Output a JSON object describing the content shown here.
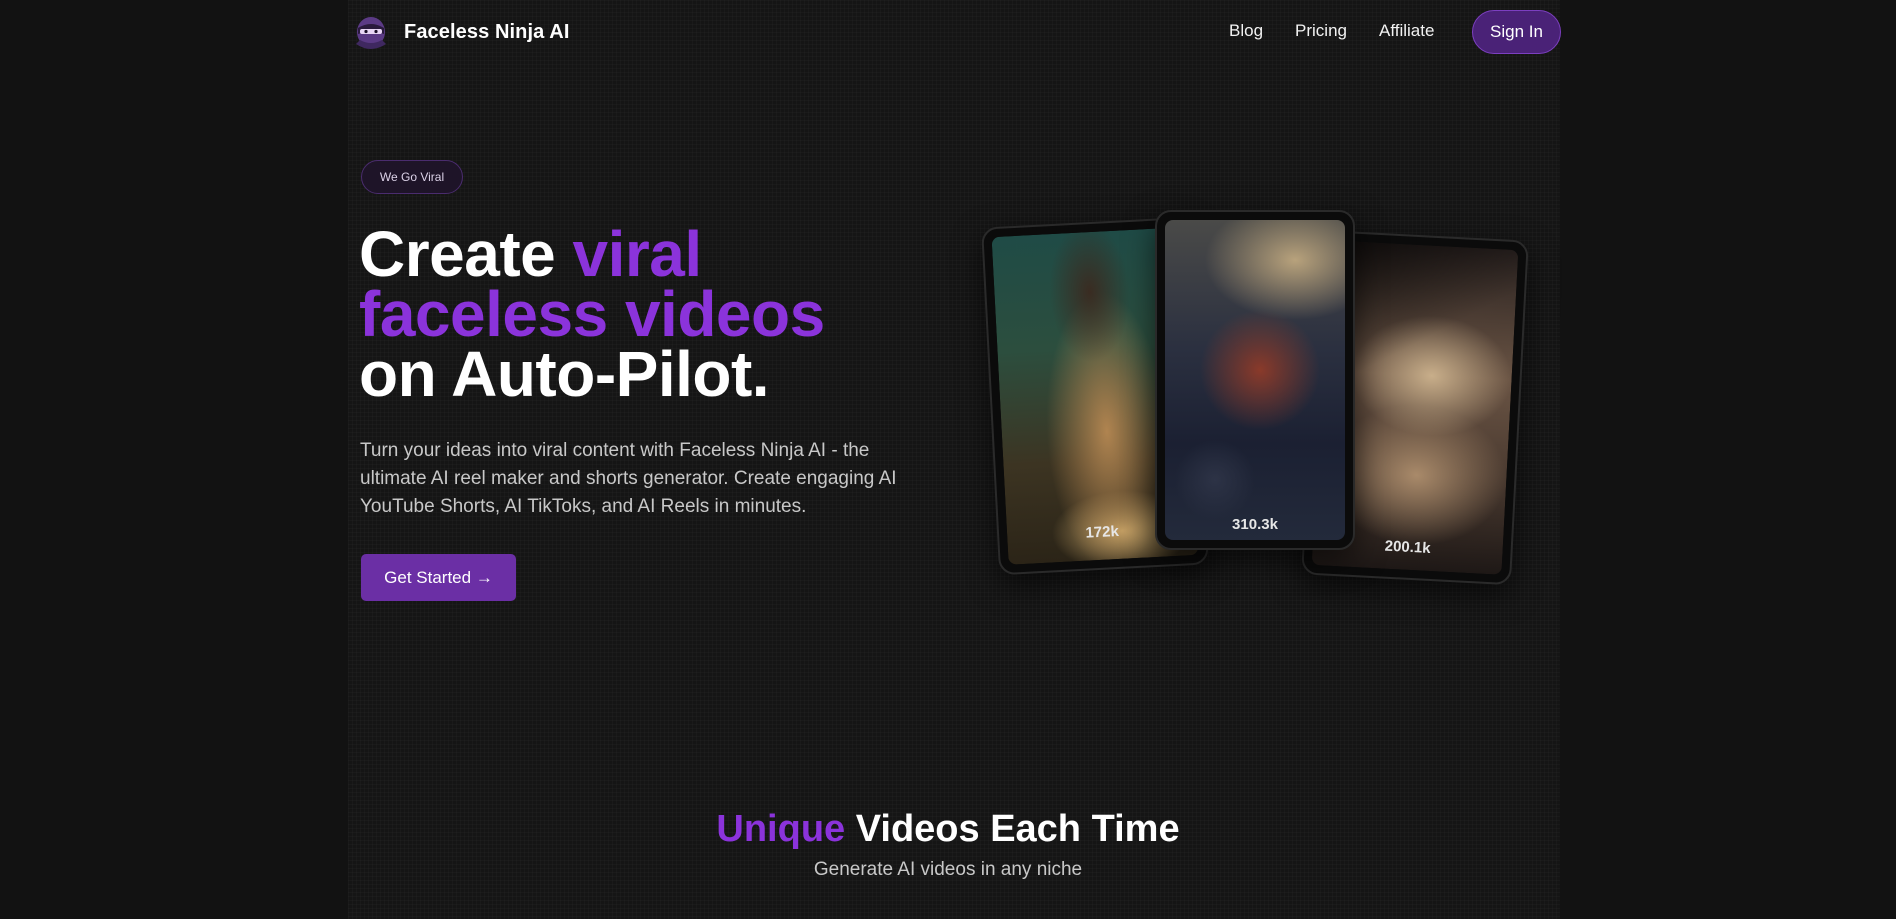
{
  "nav": {
    "brand": "Faceless Ninja AI",
    "logo_icon": "ninja-logo-icon",
    "links": [
      "Blog",
      "Pricing",
      "Affiliate"
    ],
    "signin": "Sign In"
  },
  "hero": {
    "badge": "We Go Viral",
    "headline": {
      "part1": "Create ",
      "highlight": "viral faceless videos",
      "part2": "on Auto-Pilot."
    },
    "subtext": "Turn your ideas into viral content with Faceless Ninja AI - the ultimate AI reel maker and shorts generator. Create engaging AI YouTube Shorts, AI TikToks, and AI Reels in minutes.",
    "cta": "Get Started →"
  },
  "previews": [
    {
      "views": "172k"
    },
    {
      "views": "310.3k"
    },
    {
      "views": "200.1k"
    }
  ],
  "section": {
    "title_highlight": "Unique",
    "title_rest": " Videos Each Time",
    "subtitle": "Generate AI videos in any niche"
  },
  "colors": {
    "accent": "#8b33db",
    "button": "#6b2fa5",
    "background": "#121212"
  }
}
